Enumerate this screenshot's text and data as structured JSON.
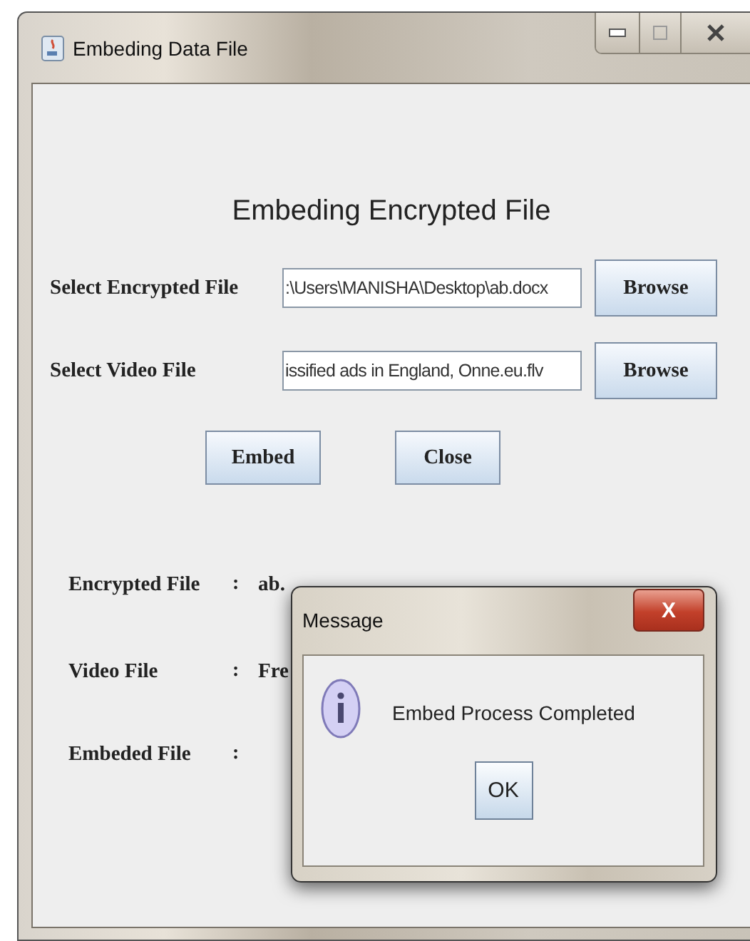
{
  "window": {
    "title": "Embeding Data File"
  },
  "heading": "Embeding Encrypted File",
  "inputs": [
    {
      "label": "Select Encrypted File",
      "value": ":\\Users\\MANISHA\\Desktop\\ab.docx",
      "button": "Browse"
    },
    {
      "label": "Select Video File",
      "value": "issified ads in England, Onne.eu.flv",
      "button": "Browse"
    }
  ],
  "actions": [
    "Embed",
    "Close"
  ],
  "results": [
    {
      "label": "Encrypted File",
      "separator": ":",
      "value": "ab."
    },
    {
      "label": "Video File",
      "separator": ":",
      "value": "Fre"
    },
    {
      "label": "Embeded File",
      "separator": ":"
    }
  ],
  "dialog": {
    "title": "Message",
    "close": "X",
    "message": "Embed Process Completed",
    "button": "OK"
  }
}
